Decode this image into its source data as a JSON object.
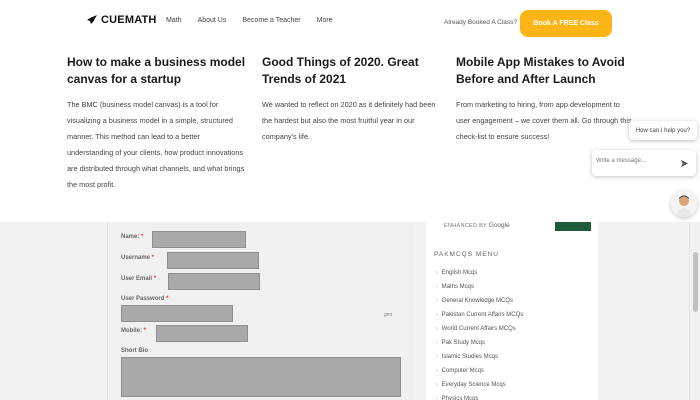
{
  "header": {
    "logo": "CUEMATH",
    "nav": [
      "Math",
      "About Us",
      "Become a Teacher",
      "More"
    ],
    "already_booked": "Already Booked A Class?",
    "cta": "Book A FREE Class"
  },
  "blog": {
    "cards": [
      {
        "title": "How to make a business model canvas for a startup",
        "text": "The BMC (business model canvas) is a tool for visualizing a business model in a simple, structured manner. This method can lead to a better understanding of your clients, how product innovations are distributed through what channels, and what brings the most profit."
      },
      {
        "title": "Good Things of 2020. Great Trends of 2021",
        "text": "We wanted to reflect on 2020 as it definitely had been the hardest but also the most fruitful year in our company's life."
      },
      {
        "title": "Mobile App Mistakes to Avoid Before and After Launch",
        "text": "From marketing to hiring, from app development to user engagement – we cover them all. Go through this check-list to ensure success!"
      }
    ]
  },
  "form": {
    "name_label": "Name:",
    "username_label": "Username",
    "email_label": "User Email",
    "password_label": "User Password",
    "mobile_label": "Mobile:",
    "bio_label": "Short Bio",
    "required_mark": "*",
    "gen_text": "gen"
  },
  "sidebar": {
    "enhanced_by": "ENHANCED BY",
    "google": "Google",
    "menu_title": "PAKMCQS MENU",
    "menu_items": [
      "English Mcqs",
      "Maths Mcqs",
      "General Knowledge MCQs",
      "Pakistan Current Affairs MCQs",
      "World Current Affairs MCQs",
      "Pak Study Mcqs",
      "Islamic Studies Mcqs",
      "Computer Mcqs",
      "Everyday Science Mcqs",
      "Physics Mcqs"
    ]
  },
  "chat": {
    "question": "How can I help you?",
    "placeholder": "Write a message..."
  },
  "colors": {
    "accent": "#fdb515",
    "search_button": "#1f5a3a",
    "input_redacted": "#a9a9a9"
  }
}
